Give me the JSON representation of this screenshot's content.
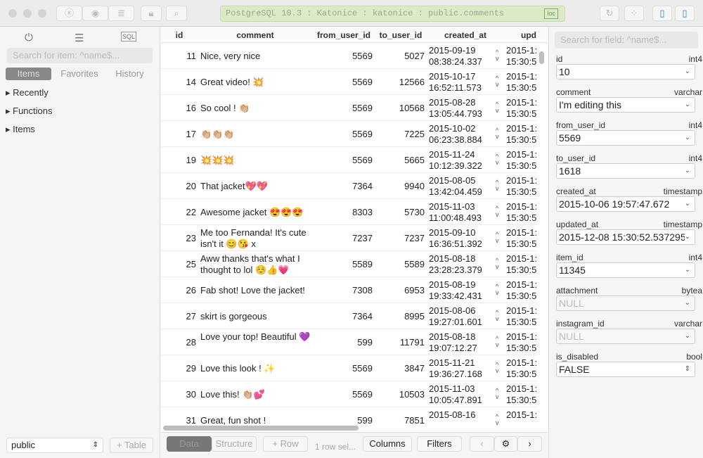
{
  "toolbar": {
    "connection": "PostgreSQL 10.3 : Katonice : katonice : public.comments",
    "loc": "loc"
  },
  "sidebar": {
    "search_placeholder": "Search for item: ^name$...",
    "tabs": [
      "Items",
      "Favorites",
      "History"
    ],
    "tree": [
      "Recently",
      "Functions",
      "Items"
    ],
    "schema": "public",
    "add_table": "+ Table"
  },
  "grid": {
    "columns": [
      "id",
      "comment",
      "from_user_id",
      "to_user_id",
      "created_at",
      "upd"
    ],
    "rows": [
      [
        "11",
        "Nice, very nice",
        "5569",
        "5027",
        "2015-09-19",
        "08:38:24.337",
        "2015-1:",
        "15:30:5"
      ],
      [
        "14",
        "Great video! 💥",
        "5569",
        "12566",
        "2015-10-17",
        "16:52:11.573",
        "2015-1:",
        "15:30:5"
      ],
      [
        "16",
        "So cool ! 👏🏼",
        "5569",
        "10568",
        "2015-08-28",
        "13:05:44.793",
        "2015-1:",
        "15:30:5"
      ],
      [
        "17",
        "👏🏼👏🏼👏🏼",
        "5569",
        "7225",
        "2015-10-02",
        "06:23:38.884",
        "2015-1:",
        "15:30:5"
      ],
      [
        "19",
        "💥💥💥",
        "5569",
        "5665",
        "2015-11-24",
        "10:12:39.322",
        "2015-1:",
        "15:30:5"
      ],
      [
        "20",
        "That jacket💖💖",
        "7364",
        "9940",
        "2015-08-05",
        "13:42:04.459",
        "2015-1:",
        "15:30:5"
      ],
      [
        "22",
        "Awesome jacket 😍😍😍",
        "8303",
        "5730",
        "2015-11-03",
        "11:00:48.493",
        "2015-1:",
        "15:30:5"
      ],
      [
        "23",
        "Me too Fernanda! It's cute isn't it 😊😘 x",
        "7237",
        "7237",
        "2015-09-10",
        "16:36:51.392",
        "2015-1:",
        "15:30:5"
      ],
      [
        "25",
        "Aww thanks that's what I thought to lol ☺️👍💗",
        "5589",
        "5589",
        "2015-08-18",
        "23:28:23.379",
        "2015-1:",
        "15:30:5"
      ],
      [
        "26",
        "Fab shot! Love the jacket!",
        "7308",
        "6953",
        "2015-08-19",
        "19:33:42.431",
        "2015-1:",
        "15:30:5"
      ],
      [
        "27",
        "skirt is gorgeous",
        "7364",
        "8995",
        "2015-08-06",
        "19:27:01.601",
        "2015-1:",
        "15:30:5"
      ],
      [
        "28",
        "Love your top! Beautiful 💜",
        "599",
        "11791",
        "2015-08-18",
        "19:07:12.27",
        "2015-1:",
        "15:30:5"
      ],
      [
        "29",
        "Love this look ! ✨",
        "5569",
        "3847",
        "2015-11-21",
        "19:36:27.168",
        "2015-1:",
        "15:30:5"
      ],
      [
        "30",
        "Love this! 👏🏼💕",
        "5569",
        "10503",
        "2015-11-03",
        "10:05:47.891",
        "2015-1:",
        "15:30:5"
      ],
      [
        "31",
        "Great, fun shot !",
        "599",
        "7851",
        "2015-08-16",
        "",
        "2015-1:",
        ""
      ]
    ]
  },
  "footer": {
    "data": "Data",
    "structure": "Structure",
    "add_row": "+ Row",
    "status": "1 row sel...",
    "columns": "Columns",
    "filters": "Filters"
  },
  "editor": {
    "search_placeholder": "Search for field: ^name$...",
    "fields": [
      {
        "name": "id",
        "type": "int4",
        "value": "10"
      },
      {
        "name": "comment",
        "type": "varchar",
        "value": "I'm editing this"
      },
      {
        "name": "from_user_id",
        "type": "int4",
        "value": "5569"
      },
      {
        "name": "to_user_id",
        "type": "int4",
        "value": "1618"
      },
      {
        "name": "created_at",
        "type": "timestamp",
        "value": "2015-10-06 19:57:47.672"
      },
      {
        "name": "updated_at",
        "type": "timestamp",
        "value": "2015-12-08 15:30:52.537295"
      },
      {
        "name": "item_id",
        "type": "int4",
        "value": "11345"
      },
      {
        "name": "attachment",
        "type": "bytea",
        "value": "NULL"
      },
      {
        "name": "instagram_id",
        "type": "varchar",
        "value": "NULL"
      },
      {
        "name": "is_disabled",
        "type": "bool",
        "value": "FALSE"
      }
    ]
  }
}
